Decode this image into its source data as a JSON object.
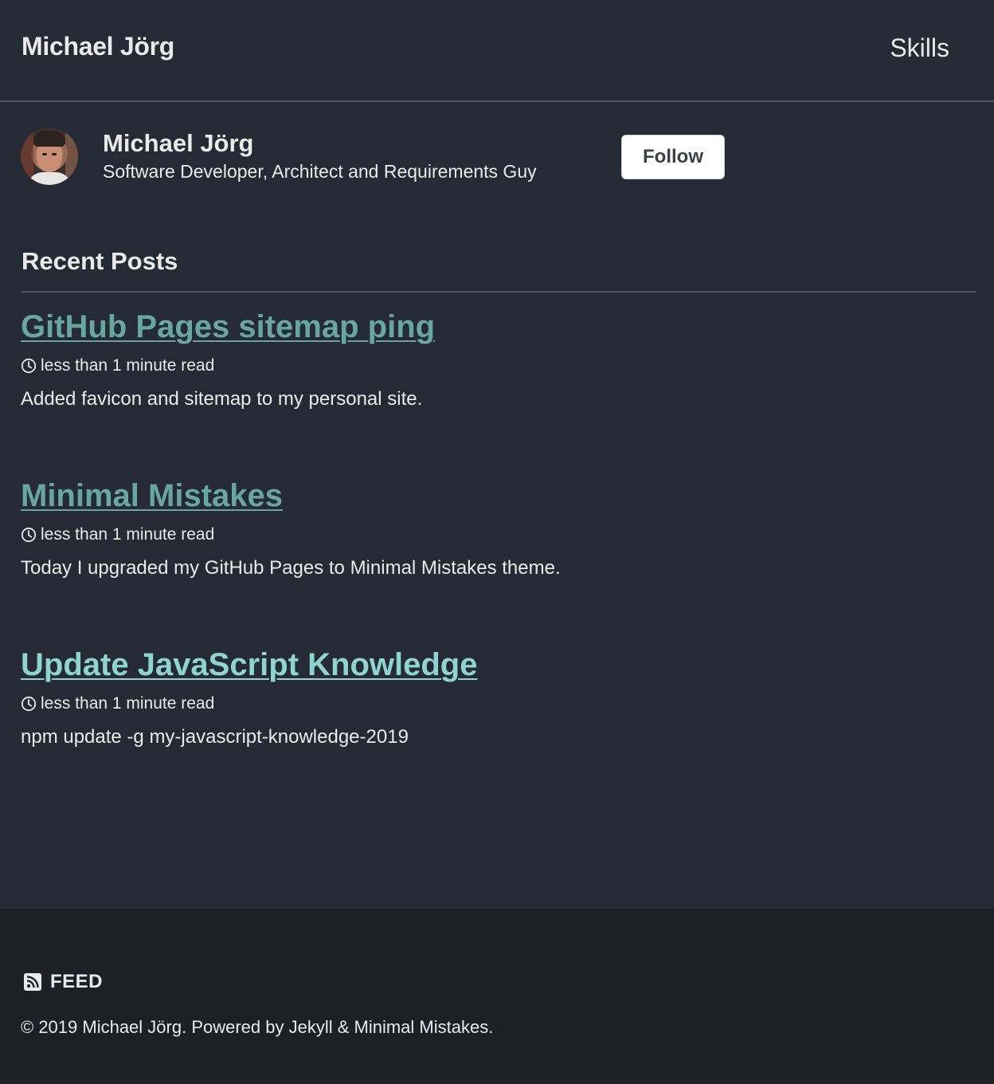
{
  "masthead": {
    "site_title": "Michael Jörg",
    "nav": [
      {
        "label": "Skills"
      }
    ]
  },
  "author": {
    "name": "Michael Jörg",
    "bio": "Software Developer, Architect and Requirements Guy",
    "follow_label": "Follow"
  },
  "recent_posts": {
    "title": "Recent Posts",
    "posts": [
      {
        "title": "GitHub Pages sitemap ping",
        "read_time": "less than 1 minute read",
        "excerpt": "Added favicon and sitemap to my personal site.",
        "link_color": "#67a6a1"
      },
      {
        "title": "Minimal Mistakes",
        "read_time": "less than 1 minute read",
        "excerpt": "Today I upgraded my GitHub Pages to Minimal Mistakes theme.",
        "link_color": "#67a6a1"
      },
      {
        "title": "Update JavaScript Knowledge",
        "read_time": "less than 1 minute read",
        "excerpt": "npm update -g my-javascript-knowledge-2019",
        "link_color": "#8ed4cf"
      }
    ]
  },
  "footer": {
    "feed_label": "FEED",
    "copyright": "© 2019 Michael Jörg. Powered by Jekyll & Minimal Mistakes."
  },
  "colors": {
    "background": "#252a34",
    "footer_background": "#1d2027",
    "text": "#eaeaea",
    "link_visited": "#67a6a1",
    "link": "#8ed4cf"
  },
  "icons": {
    "clock": "clock-icon",
    "rss": "rss-icon"
  }
}
